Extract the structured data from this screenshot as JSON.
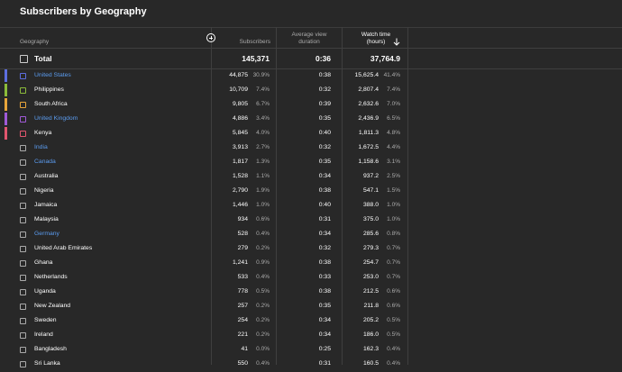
{
  "page": {
    "title": "Subscribers by Geography"
  },
  "columns": {
    "geography": "Geography",
    "subscribers": "Subscribers",
    "avg_view_line1": "Average view",
    "avg_view_line2": "duration",
    "watch_line1": "Watch time",
    "watch_line2": "(hours)"
  },
  "total": {
    "label": "Total",
    "subscribers": "145,371",
    "avg_view": "0:36",
    "watch_time": "37,764.9"
  },
  "colors": {
    "link": "#5b9cf0",
    "series": [
      "#5d6ee0",
      "#8cbc3a",
      "#e8a53a",
      "#a05ad8",
      "#e2566e"
    ]
  },
  "rows": [
    {
      "country": "United States",
      "subs": "44,875",
      "subs_pct": "30.9%",
      "avg": "0:38",
      "watch": "15,625.4",
      "watch_pct": "41.4%",
      "link": true,
      "color": "#5d6ee0"
    },
    {
      "country": "Philippines",
      "subs": "10,709",
      "subs_pct": "7.4%",
      "avg": "0:32",
      "watch": "2,807.4",
      "watch_pct": "7.4%",
      "link": false,
      "color": "#8cbc3a"
    },
    {
      "country": "South Africa",
      "subs": "9,805",
      "subs_pct": "6.7%",
      "avg": "0:39",
      "watch": "2,632.6",
      "watch_pct": "7.0%",
      "link": false,
      "color": "#e8a53a"
    },
    {
      "country": "United Kingdom",
      "subs": "4,886",
      "subs_pct": "3.4%",
      "avg": "0:35",
      "watch": "2,436.9",
      "watch_pct": "6.5%",
      "link": true,
      "color": "#a05ad8"
    },
    {
      "country": "Kenya",
      "subs": "5,845",
      "subs_pct": "4.0%",
      "avg": "0:40",
      "watch": "1,811.3",
      "watch_pct": "4.8%",
      "link": false,
      "color": "#e2566e"
    },
    {
      "country": "India",
      "subs": "3,913",
      "subs_pct": "2.7%",
      "avg": "0:32",
      "watch": "1,672.5",
      "watch_pct": "4.4%",
      "link": true
    },
    {
      "country": "Canada",
      "subs": "1,817",
      "subs_pct": "1.3%",
      "avg": "0:35",
      "watch": "1,158.6",
      "watch_pct": "3.1%",
      "link": true
    },
    {
      "country": "Australia",
      "subs": "1,528",
      "subs_pct": "1.1%",
      "avg": "0:34",
      "watch": "937.2",
      "watch_pct": "2.5%",
      "link": false
    },
    {
      "country": "Nigeria",
      "subs": "2,790",
      "subs_pct": "1.9%",
      "avg": "0:38",
      "watch": "547.1",
      "watch_pct": "1.5%",
      "link": false
    },
    {
      "country": "Jamaica",
      "subs": "1,446",
      "subs_pct": "1.0%",
      "avg": "0:40",
      "watch": "388.0",
      "watch_pct": "1.0%",
      "link": false
    },
    {
      "country": "Malaysia",
      "subs": "934",
      "subs_pct": "0.6%",
      "avg": "0:31",
      "watch": "375.0",
      "watch_pct": "1.0%",
      "link": false
    },
    {
      "country": "Germany",
      "subs": "528",
      "subs_pct": "0.4%",
      "avg": "0:34",
      "watch": "285.6",
      "watch_pct": "0.8%",
      "link": true
    },
    {
      "country": "United Arab Emirates",
      "subs": "279",
      "subs_pct": "0.2%",
      "avg": "0:32",
      "watch": "279.3",
      "watch_pct": "0.7%",
      "link": false
    },
    {
      "country": "Ghana",
      "subs": "1,241",
      "subs_pct": "0.9%",
      "avg": "0:38",
      "watch": "254.7",
      "watch_pct": "0.7%",
      "link": false
    },
    {
      "country": "Netherlands",
      "subs": "533",
      "subs_pct": "0.4%",
      "avg": "0:33",
      "watch": "253.0",
      "watch_pct": "0.7%",
      "link": false
    },
    {
      "country": "Uganda",
      "subs": "778",
      "subs_pct": "0.5%",
      "avg": "0:38",
      "watch": "212.5",
      "watch_pct": "0.6%",
      "link": false
    },
    {
      "country": "New Zealand",
      "subs": "257",
      "subs_pct": "0.2%",
      "avg": "0:35",
      "watch": "211.8",
      "watch_pct": "0.6%",
      "link": false
    },
    {
      "country": "Sweden",
      "subs": "254",
      "subs_pct": "0.2%",
      "avg": "0:34",
      "watch": "205.2",
      "watch_pct": "0.5%",
      "link": false
    },
    {
      "country": "Ireland",
      "subs": "221",
      "subs_pct": "0.2%",
      "avg": "0:34",
      "watch": "186.0",
      "watch_pct": "0.5%",
      "link": false
    },
    {
      "country": "Bangladesh",
      "subs": "41",
      "subs_pct": "0.0%",
      "avg": "0:25",
      "watch": "162.3",
      "watch_pct": "0.4%",
      "link": false
    },
    {
      "country": "Sri Lanka",
      "subs": "550",
      "subs_pct": "0.4%",
      "avg": "0:31",
      "watch": "160.5",
      "watch_pct": "0.4%",
      "link": false
    }
  ]
}
